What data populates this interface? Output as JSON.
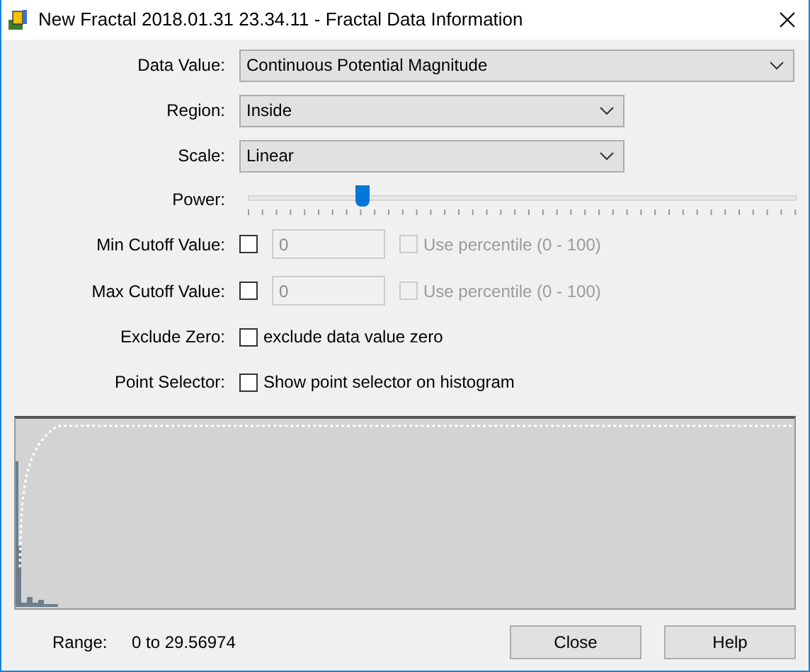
{
  "window": {
    "title": "New Fractal 2018.01.31 23.34.11 - Fractal Data Information"
  },
  "fields": [
    {
      "kind": "dropdown",
      "label": "Data Value:",
      "value": "Continuous Potential Magnitude"
    },
    {
      "kind": "dropdown",
      "label": "Region:",
      "value": "Inside"
    },
    {
      "kind": "dropdown",
      "label": "Scale:",
      "value": "Linear"
    },
    {
      "kind": "slider",
      "label": "Power:",
      "level": 0.21
    },
    {
      "kind": "cutoff",
      "label": "Min Cutoff Value:",
      "checked": false,
      "value": "0",
      "disabled": true,
      "percentile": {
        "label": "Use percentile (0 - 100)",
        "checked": false,
        "disabled": true
      }
    },
    {
      "kind": "cutoff",
      "label": "Max Cutoff Value:",
      "checked": false,
      "value": "0",
      "disabled": true,
      "percentile": {
        "label": "Use percentile (0 - 100)",
        "checked": false,
        "disabled": true
      }
    },
    {
      "kind": "check",
      "label": "Exclude Zero:",
      "checked": false,
      "text": "exclude data value zero"
    },
    {
      "kind": "check",
      "label": "Point Selector:",
      "checked": false,
      "text": "Show point selector on histogram"
    }
  ],
  "range": {
    "label": "Range:",
    "value": "0 to 29.56974"
  },
  "buttons": [
    "Close",
    "Help"
  ]
}
